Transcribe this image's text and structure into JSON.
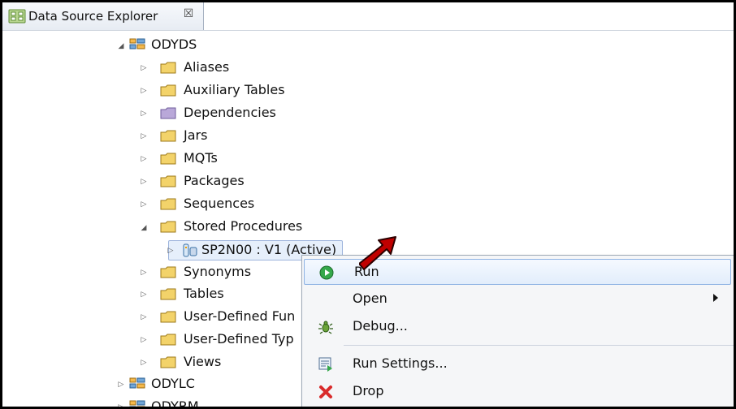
{
  "tab": {
    "title": "Data Source Explorer",
    "close_symbol": "☒",
    "icon": "data-source-explorer-icon"
  },
  "tree": {
    "database_nodes": [
      {
        "label": "ODYDS",
        "expanded": true
      },
      {
        "label": "ODYLC",
        "expanded": false
      },
      {
        "label": "ODYRM",
        "expanded": false
      }
    ],
    "folders": [
      {
        "label": "Aliases",
        "expanded": false
      },
      {
        "label": "Auxiliary Tables",
        "expanded": false
      },
      {
        "label": "Dependencies",
        "expanded": false,
        "color": "#b9a8d9"
      },
      {
        "label": "Jars",
        "expanded": false
      },
      {
        "label": "MQTs",
        "expanded": false
      },
      {
        "label": "Packages",
        "expanded": false
      },
      {
        "label": "Sequences",
        "expanded": false
      },
      {
        "label": "Stored Procedures",
        "expanded": true
      },
      {
        "label": "Synonyms",
        "expanded": false
      },
      {
        "label": "Tables",
        "expanded": false
      },
      {
        "label": "User-Defined Fun",
        "expanded": false
      },
      {
        "label": "User-Defined Typ",
        "expanded": false
      },
      {
        "label": "Views",
        "expanded": false
      }
    ],
    "stored_procedure": {
      "label": "SP2N00 : V1 (Active)",
      "selected": true
    }
  },
  "context_menu": {
    "items": [
      {
        "label": "Run",
        "icon": "run-icon",
        "highlighted": true
      },
      {
        "label": "Open",
        "icon": "",
        "has_submenu": true
      },
      {
        "label": "Debug...",
        "icon": "debug-bug-icon"
      },
      {
        "label": "Run Settings...",
        "icon": "run-settings-icon"
      },
      {
        "label": "Drop",
        "icon": "drop-red-x-icon"
      }
    ]
  },
  "colors": {
    "folder": "#f3d36a",
    "dependencies_folder": "#b9a8d9",
    "menu_selection": "#e2edfb",
    "arrow": "#c00000"
  }
}
